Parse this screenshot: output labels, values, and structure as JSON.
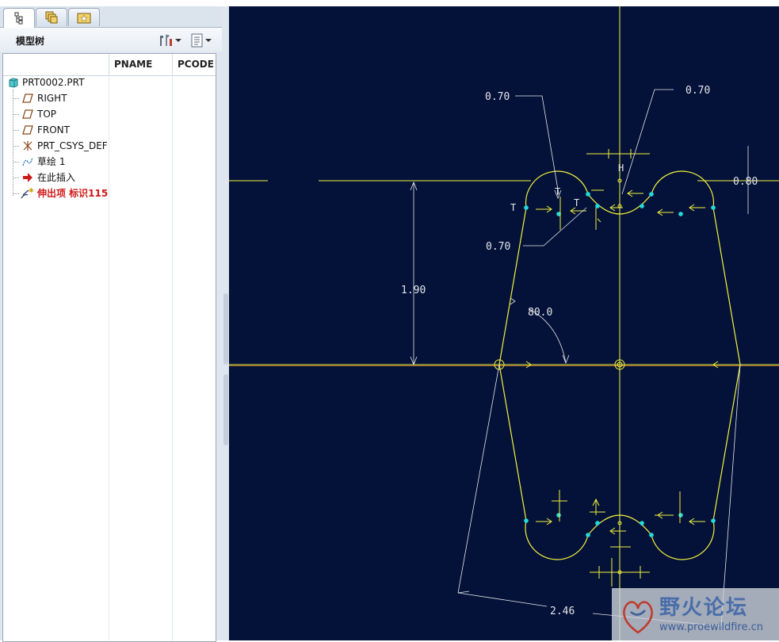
{
  "tabs": [
    {
      "name": "model-tree-tab",
      "icon": "tree-icon"
    },
    {
      "name": "layers-tab",
      "icon": "layers-icon"
    },
    {
      "name": "favorites-tab",
      "icon": "star-folder-icon"
    }
  ],
  "panel": {
    "title": "模型树",
    "settings_icon": "tools-icon",
    "show_icon": "list-icon"
  },
  "columns": {
    "pname": "PNAME",
    "pcode": "PCODE"
  },
  "tree": {
    "root": "PRT0002.PRT",
    "items": [
      {
        "label": "RIGHT",
        "icon": "datum-plane-icon"
      },
      {
        "label": "TOP",
        "icon": "datum-plane-icon"
      },
      {
        "label": "FRONT",
        "icon": "datum-plane-icon"
      },
      {
        "label": "PRT_CSYS_DEF",
        "icon": "csys-icon"
      },
      {
        "label": "草绘 1",
        "icon": "sketch-icon"
      },
      {
        "label": "在此插入",
        "icon": "insert-arrow-icon"
      },
      {
        "label": "伸出项 标识115",
        "icon": "extrude-icon"
      }
    ]
  },
  "sketch": {
    "dims": {
      "d1": "0.70",
      "d2": "0.70",
      "d3": "0.70",
      "d4": "0.80",
      "height": "1.90",
      "angle": "80.0",
      "width": "2.46"
    },
    "constraint_t": "T",
    "colors": {
      "background": "#04123a",
      "geometry": "#f2f23a",
      "dimension": "#e6e6e6",
      "vertex": "#22dcdc"
    }
  },
  "watermark": {
    "title": "野火论坛",
    "url": "www.proewildfire.cn"
  }
}
